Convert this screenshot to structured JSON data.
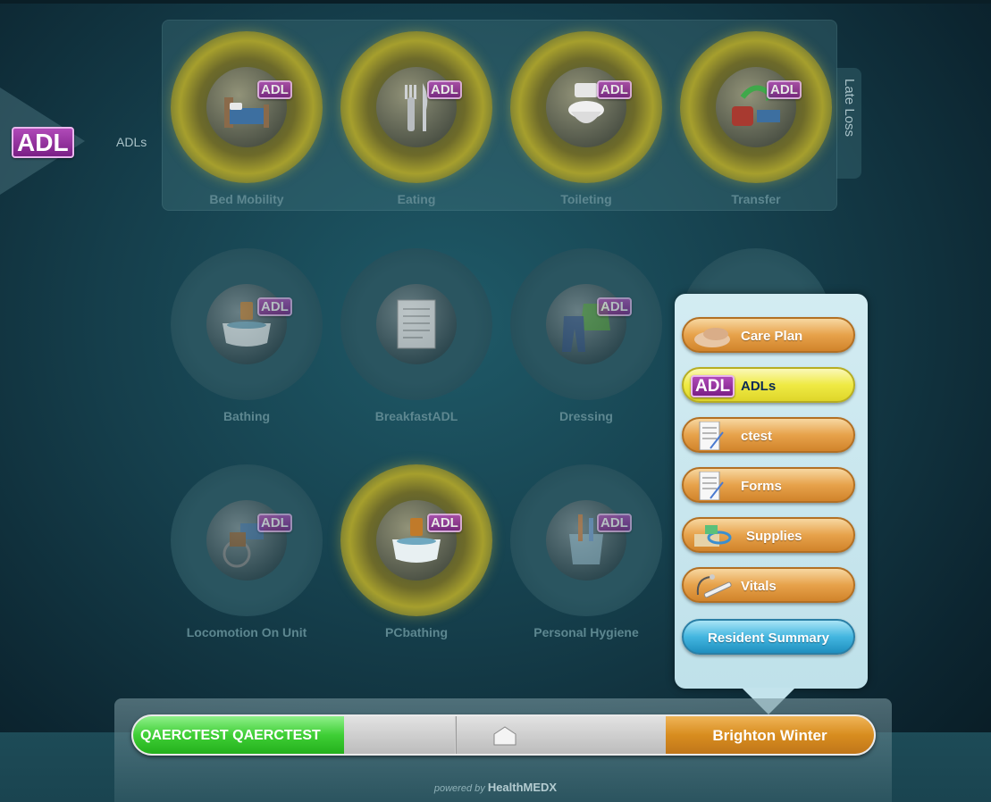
{
  "header": {
    "badge": "ADL",
    "section_label": "ADLs",
    "group_title": "Late Loss"
  },
  "tiles": [
    {
      "label": "Bed Mobility",
      "badge": "ADL",
      "icon": "bed-icon",
      "active": true
    },
    {
      "label": "Eating",
      "badge": "ADL",
      "icon": "fork-knife-icon",
      "active": true
    },
    {
      "label": "Toileting",
      "badge": "ADL",
      "icon": "toilet-icon",
      "active": true
    },
    {
      "label": "Transfer",
      "badge": "ADL",
      "icon": "transfer-chair-icon",
      "active": true
    },
    {
      "label": "Bathing",
      "badge": "ADL",
      "icon": "bathtub-icon",
      "active": false
    },
    {
      "label": "BreakfastADL",
      "badge": "",
      "icon": "form-icon",
      "active": false
    },
    {
      "label": "Dressing",
      "badge": "ADL",
      "icon": "clothes-icon",
      "active": false
    },
    {
      "label": "Locomotion On Unit",
      "badge": "ADL",
      "icon": "wheelchair-icon",
      "active": false
    },
    {
      "label": "PCbathing",
      "badge": "ADL",
      "icon": "bathtub-icon",
      "active": true
    },
    {
      "label": "Personal Hygiene",
      "badge": "ADL",
      "icon": "toothbrush-cup-icon",
      "active": false
    }
  ],
  "menu": {
    "items": [
      {
        "label": "Care Plan",
        "icon": "hands-icon"
      },
      {
        "label": "ADLs",
        "icon": "adl-badge-icon",
        "badge": "ADL",
        "selected": true
      },
      {
        "label": "ctest",
        "icon": "form-icon"
      },
      {
        "label": "Forms",
        "icon": "form-icon"
      },
      {
        "label": "Supplies",
        "icon": "supplies-icon"
      },
      {
        "label": "Vitals",
        "icon": "thermometer-icon"
      }
    ],
    "summary_label": "Resident Summary"
  },
  "statusbar": {
    "resident_name": "QAERCTEST QAERCTEST",
    "unit_name": "Brighton Winter",
    "home_icon": "home-icon"
  },
  "footer": {
    "powered_prefix": "powered by",
    "brand": "HealthMEDX"
  },
  "colors": {
    "accent_orange": "#d88d1f",
    "accent_green": "#3fcf36",
    "selected_yellow": "#efea44",
    "badge_purple": "#9b2fa6"
  }
}
